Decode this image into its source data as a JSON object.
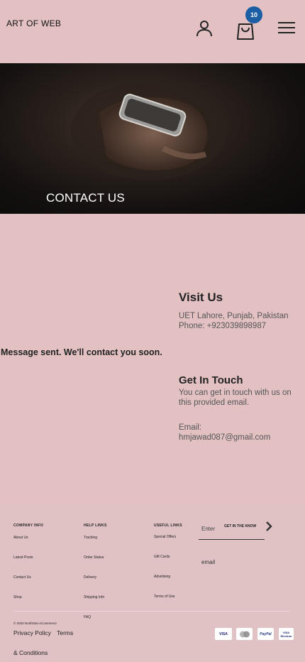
{
  "header": {
    "brand": "ART OF WEB",
    "cart_count": "10",
    "icons": [
      "user-icon",
      "shopping-bag-icon",
      "hamburger-menu-icon"
    ]
  },
  "hero": {
    "title": "CONTACT US"
  },
  "contact": {
    "status_message": "Message sent. We'll contact you soon.",
    "visit": {
      "heading": "Visit Us",
      "address": "UET Lahore, Punjab, Pakistan",
      "phone": "Phone: +923039898987"
    },
    "touch": {
      "heading": "Get In Touch",
      "text": "You can get in touch with us on this provided email.",
      "email_label": "Email:",
      "email": "hmjawad087@gmail.com"
    }
  },
  "footer": {
    "company": {
      "heading": "COMPANY INFO",
      "links": [
        "About Us",
        "Latest Posts",
        "Contact Us",
        "Shop"
      ]
    },
    "help": {
      "heading": "HELP LINKS",
      "links": [
        "Tracking",
        "Order Status",
        "Delivery",
        "Shipping Info",
        "FAQ"
      ]
    },
    "useful": {
      "heading": "USEFUL LINKS",
      "links": [
        "Special Offers",
        "Gift Cards",
        "Advetising",
        "Terms of Use"
      ]
    },
    "newsletter": {
      "placeholder": "Enter",
      "label": "GET IN THE KNOW",
      "email_label": "email"
    },
    "copyright": "© 2020 NorthStar eCommerce",
    "legal": {
      "privacy": "Privacy Policy",
      "terms": "Terms",
      "conditions": "& Conditions"
    },
    "payments": {
      "visa": "VISA",
      "mastercard": "",
      "paypal": "PayPal",
      "visa_electron_1": "VISA",
      "visa_electron_2": "Electron"
    }
  },
  "colors": {
    "background": "#e3c1c3",
    "badge": "#1c5ea4",
    "hero_text": "#ffffff"
  }
}
